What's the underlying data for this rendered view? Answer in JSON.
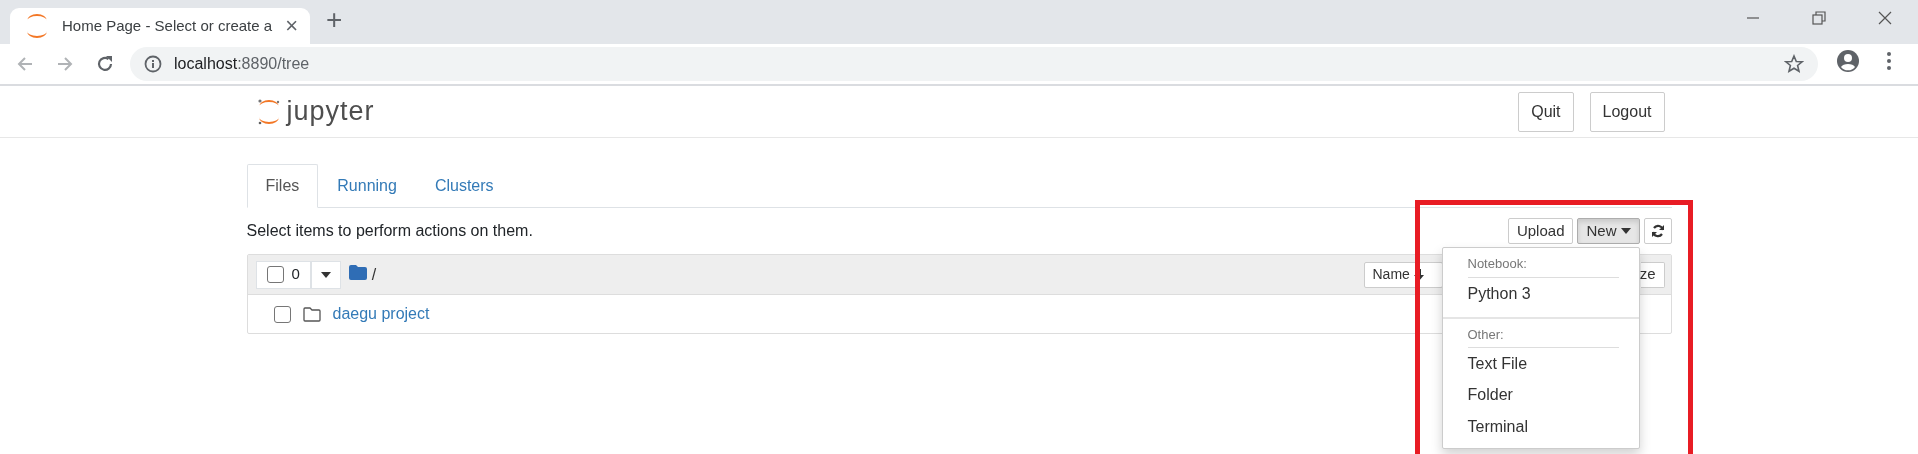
{
  "browser": {
    "tab": {
      "title": "Home Page - Select or create a",
      "close": "×"
    },
    "new_tab": "+",
    "url_host": "localhost",
    "url_path": ":8890/tree"
  },
  "header": {
    "logo_text": "jupyter",
    "buttons": [
      "Quit",
      "Logout"
    ]
  },
  "tabs": [
    {
      "label": "Files",
      "selected": true
    },
    {
      "label": "Running",
      "selected": false
    },
    {
      "label": "Clusters",
      "selected": false
    }
  ],
  "hint": "Select items to perform actions on them.",
  "toolbar": [
    {
      "kind": "plain",
      "label": "Upload"
    },
    {
      "kind": "dropdown",
      "label": "New",
      "expanded": true
    },
    {
      "kind": "refresh"
    }
  ],
  "list": {
    "select_all": {
      "checked": false,
      "count": "0"
    },
    "path": "/",
    "sort_buttons": [
      "Name",
      "ze"
    ],
    "items": [
      {
        "kind": "folder",
        "name": "daegu project",
        "checked": false
      }
    ]
  },
  "new_menu": [
    {
      "header": "Notebook:",
      "items": [
        "Python 3"
      ]
    },
    {
      "header": "Other:",
      "items": [
        "Text File",
        "Folder",
        "Terminal"
      ]
    }
  ]
}
